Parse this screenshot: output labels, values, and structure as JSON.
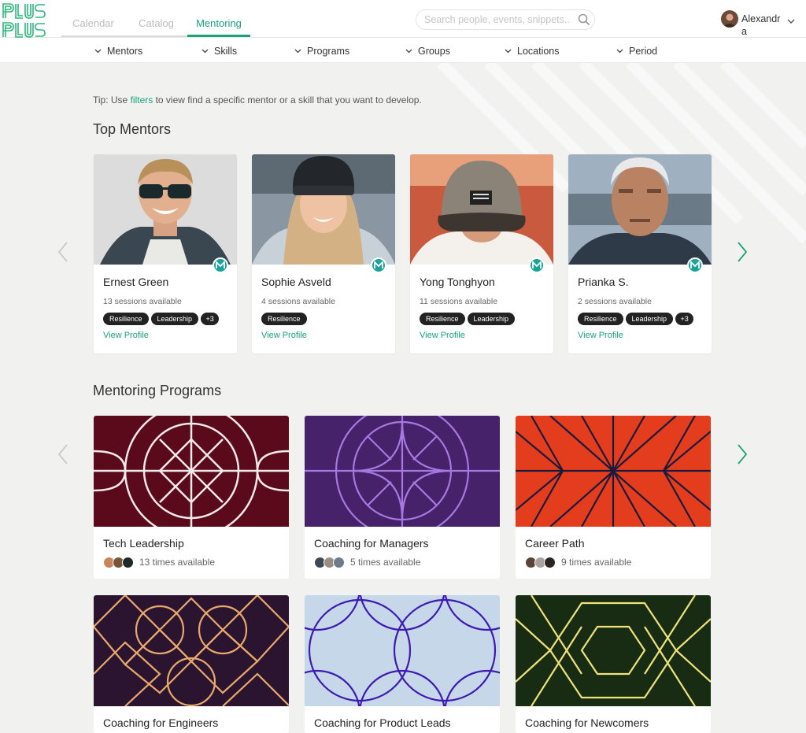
{
  "app": {
    "logo_text": "PLUS PLUS"
  },
  "nav": {
    "tabs": [
      {
        "label": "Calendar"
      },
      {
        "label": "Catalog"
      },
      {
        "label": "Mentoring"
      }
    ],
    "active": "Mentoring"
  },
  "search": {
    "placeholder": "Search people, events, snippets..."
  },
  "user": {
    "name": "Alexandra"
  },
  "filters": [
    {
      "label": "Mentors"
    },
    {
      "label": "Skills"
    },
    {
      "label": "Programs"
    },
    {
      "label": "Groups"
    },
    {
      "label": "Locations"
    },
    {
      "label": "Period"
    }
  ],
  "tip": {
    "prefix": "Tip: Use",
    "link": "filters",
    "suffix": "to view find a specific mentor or a skill that you want to develop."
  },
  "top_mentors": {
    "title": "Top Mentors",
    "mentors": [
      {
        "name": "Ernest Green",
        "sessions": "13 sessions available",
        "tags": [
          "Resilience",
          "Leadership"
        ],
        "more": "+3",
        "link": "View Profile",
        "badge": "M"
      },
      {
        "name": "Sophie Asveld",
        "sessions": "4 sessions available",
        "tags": [
          "Resilience"
        ],
        "more": "",
        "link": "View Profile",
        "badge": "M"
      },
      {
        "name": "Yong Tonghyon",
        "sessions": "11 sessions available",
        "tags": [
          "Resilience",
          "Leadership"
        ],
        "more": "",
        "link": "View Profile",
        "badge": "M"
      },
      {
        "name": "Prianka S.",
        "sessions": "2 sessions available",
        "tags": [
          "Resilience",
          "Leadership"
        ],
        "more": "+3",
        "link": "View Profile",
        "badge": "M"
      }
    ]
  },
  "mentoring_programs": {
    "title": "Mentoring Programs",
    "programs": [
      {
        "title": "Tech Leadership",
        "availability": "13 times available",
        "art_color": "#5b0a1c"
      },
      {
        "title": "Coaching for Managers",
        "availability": "5 times available",
        "art_color": "#45226a"
      },
      {
        "title": "Career Path",
        "availability": "9 times available",
        "art_color": "#e33d1e"
      },
      {
        "title": "Coaching for Engineers",
        "availability": "",
        "art_color": "#2a1430"
      },
      {
        "title": "Coaching for Product Leads",
        "availability": "",
        "art_color": "#c5d7e8"
      },
      {
        "title": "Coaching for Newcomers",
        "availability": "",
        "art_color": "#172c12"
      }
    ]
  },
  "colors": {
    "accent": "#1aa37a",
    "tag_bg": "#222222",
    "badge": "#1aa39a"
  },
  "icons": [
    "search-icon",
    "chevron-down-icon",
    "chevron-left-icon",
    "chevron-right-icon",
    "mentor-badge-icon"
  ]
}
